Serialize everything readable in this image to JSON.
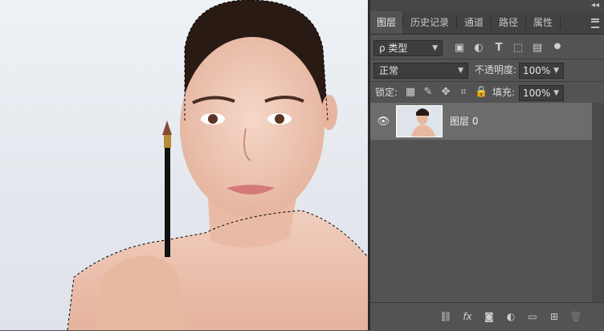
{
  "panel": {
    "collapse_label": "◂◂",
    "tabs": [
      {
        "label": "图层"
      },
      {
        "label": "历史记录"
      },
      {
        "label": "通道"
      },
      {
        "label": "路径"
      },
      {
        "label": "属性"
      }
    ],
    "filter": {
      "value": "ρ 类型"
    },
    "blend_mode": {
      "value": "正常"
    },
    "opacity": {
      "label": "不透明度:",
      "value": "100%"
    },
    "lock": {
      "label": "锁定:"
    },
    "fill": {
      "label": "填充:",
      "value": "100%"
    },
    "layers": [
      {
        "name": "图层 0",
        "visible": true
      }
    ]
  }
}
